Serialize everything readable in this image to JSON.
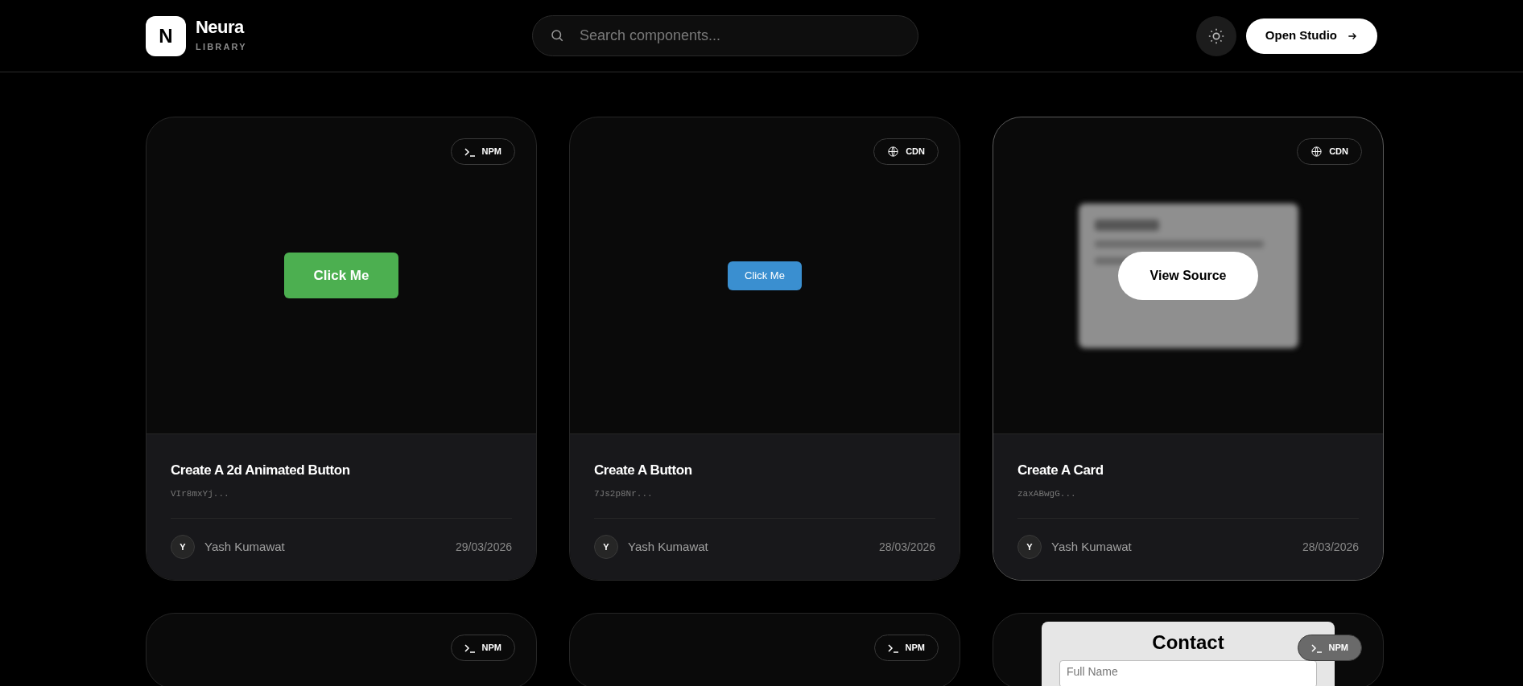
{
  "brand": {
    "logo": "N",
    "name": "Neura",
    "subtitle": "LIBRARY"
  },
  "search": {
    "placeholder": "Search components..."
  },
  "header_button": {
    "label": "Open Studio"
  },
  "cards": [
    {
      "badge": {
        "kind": "npm",
        "label": "NPM"
      },
      "preview": {
        "kind": "green_button",
        "label": "Click Me"
      },
      "title": "Create A 2d Animated Button",
      "id": "VIr8mxYj...",
      "author_initial": "Y",
      "author": "Yash Kumawat",
      "date": "29/03/2026",
      "hovered": false
    },
    {
      "badge": {
        "kind": "cdn",
        "label": "CDN"
      },
      "preview": {
        "kind": "blue_button",
        "label": "Click Me"
      },
      "title": "Create A Button",
      "id": "7Js2p8Nr...",
      "author_initial": "Y",
      "author": "Yash Kumawat",
      "date": "28/03/2026",
      "hovered": false
    },
    {
      "badge": {
        "kind": "cdn",
        "label": "CDN"
      },
      "preview": {
        "kind": "card"
      },
      "title": "Create A Card",
      "id": "zaxABwgG...",
      "author_initial": "Y",
      "author": "Yash Kumawat",
      "date": "28/03/2026",
      "hovered": true,
      "overlay_label": "View Source"
    },
    {
      "badge": {
        "kind": "npm",
        "label": "NPM"
      },
      "preview": {
        "kind": "empty"
      },
      "hovered": false
    },
    {
      "badge": {
        "kind": "npm",
        "label": "NPM"
      },
      "preview": {
        "kind": "empty"
      },
      "hovered": false
    },
    {
      "badge": {
        "kind": "npm",
        "label": "NPM"
      },
      "preview": {
        "kind": "contact",
        "heading": "Contact",
        "placeholder": "Full Name"
      },
      "hovered": false
    }
  ]
}
